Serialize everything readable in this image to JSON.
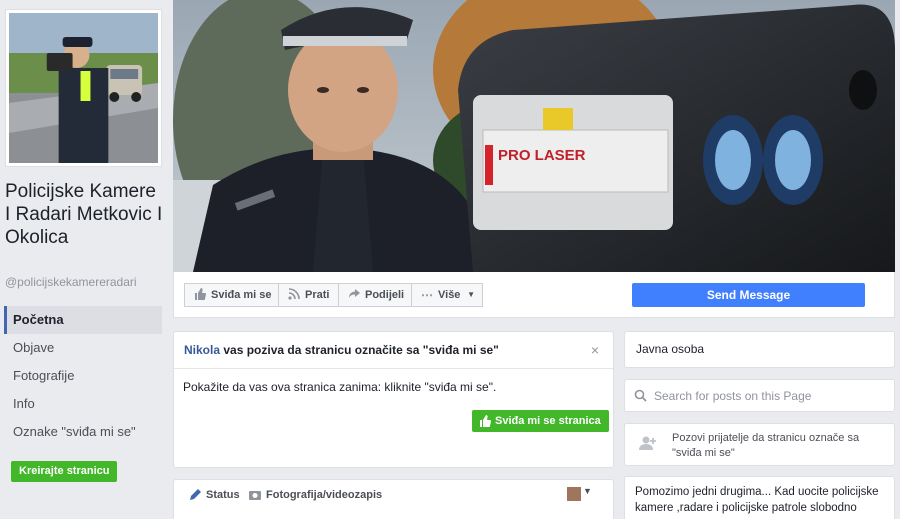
{
  "sidebar": {
    "page_name": "Policijske Kamere I Radari Metkovic I Okolica",
    "handle": "@policijskekamereradari",
    "nav": [
      "Početna",
      "Objave",
      "Fotografije",
      "Info",
      "Oznake \"sviđa mi se\""
    ],
    "create_page_label": "Kreirajte stranicu"
  },
  "cover": {
    "device_label": "PRO LASER"
  },
  "actions": {
    "like": "Sviđa mi se",
    "follow": "Prati",
    "share": "Podijeli",
    "more": "Više",
    "send_message": "Send Message"
  },
  "invite": {
    "friend": "Nikola",
    "message": "vas poziva da stranicu označite sa \"sviđa mi se\"",
    "close": "×",
    "body": "Pokažite da vas ova stranica zanima: kliknite \"sviđa mi se\".",
    "like_page_label": "Sviđa mi se stranica"
  },
  "composer": {
    "status": "Status",
    "photo_video": "Fotografija/videozapis"
  },
  "right": {
    "category": "Javna osoba",
    "search_placeholder": "Search for posts on this Page",
    "invite_friends": "Pozovi prijatelje da stranicu označe sa \"sviđa mi se\"",
    "about": "Pomozimo jedni drugima... Kad uocite policijske kamere ,radare i policijske patrole slobodno"
  },
  "colors": {
    "accent_blue": "#4080ff",
    "link_blue": "#365899",
    "green": "#42b72a",
    "background": "#e9ebee"
  },
  "icons": {
    "like": "thumbs-up-icon",
    "follow": "rss-icon",
    "share": "share-arrow-icon",
    "more": "ellipsis-icon",
    "search": "search-icon",
    "invite_friends": "add-friend-icon",
    "status": "pencil-icon",
    "photo": "camera-icon"
  }
}
